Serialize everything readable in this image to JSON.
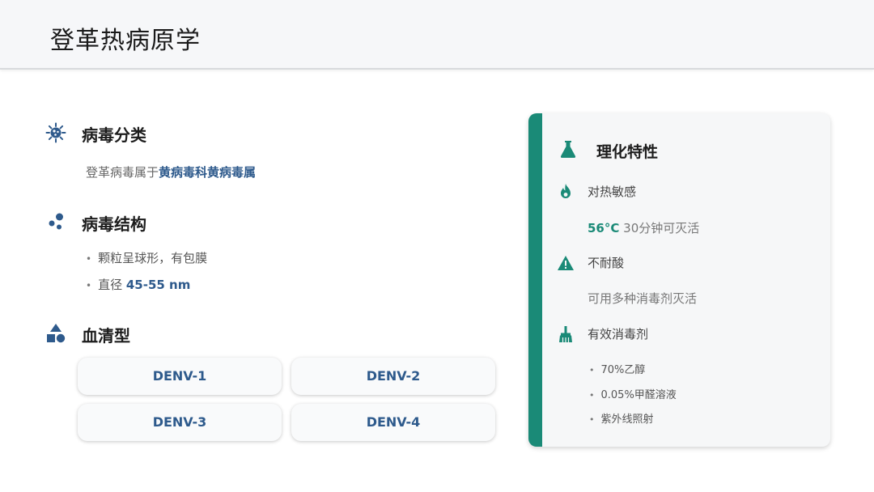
{
  "header": {
    "title": "登革热病原学"
  },
  "classification": {
    "title": "病毒分类",
    "text_prefix": "登革病毒属于",
    "text_highlight": "黄病毒科黄病毒属"
  },
  "structure": {
    "title": "病毒结构",
    "items": [
      {
        "text": "颗粒呈球形，有包膜"
      },
      {
        "prefix": "直径 ",
        "highlight": "45-55 nm"
      }
    ]
  },
  "serotypes": {
    "title": "血清型",
    "items": [
      "DENV-1",
      "DENV-2",
      "DENV-3",
      "DENV-4"
    ]
  },
  "properties": {
    "title": "理化特性",
    "heat": {
      "label": "对热敏感",
      "highlight": "56°C",
      "rest": " 30分钟可灭活"
    },
    "acid": {
      "label": "不耐酸",
      "note": "可用多种消毒剂灭活"
    },
    "disinfectants": {
      "label": "有效消毒剂",
      "items": [
        "70%乙醇",
        "0.05%甲醛溶液",
        "紫外线照射"
      ]
    }
  },
  "colors": {
    "blue": "#2e5a8c",
    "teal": "#1a8a77"
  },
  "icons": {
    "classification": "virus-icon",
    "structure": "molecule-dots-icon",
    "serotypes": "shapes-icon",
    "properties": "flask-icon",
    "heat": "fire-icon",
    "acid": "warning-icon",
    "disinfectant": "broom-icon"
  }
}
